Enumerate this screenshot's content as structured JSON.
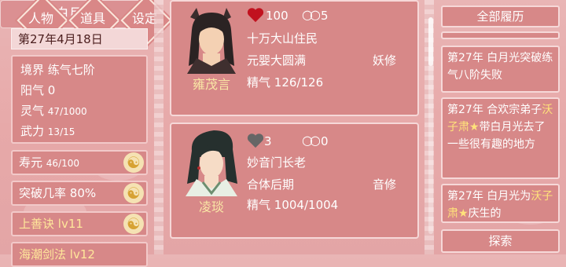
{
  "player": {
    "name": "白月光",
    "date": "第27年4月18日",
    "stats": {
      "realm_label": "境界",
      "realm_value": "练气七阶",
      "yang_label": "阳气",
      "yang_value": "0",
      "spirit_label": "灵气",
      "spirit_value": "47/1000",
      "force_label": "武力",
      "force_value": "13/15"
    },
    "lifespan_label": "寿元",
    "lifespan_value": "46/100",
    "breakthrough_label": "突破几率",
    "breakthrough_value": "80%",
    "skill1_name": "上善诀",
    "skill1_level": "lv11",
    "skill2_name": "海潮剑法",
    "skill2_level": "lv12"
  },
  "menu": {
    "character": "人物",
    "items": "道具",
    "settings": "设定"
  },
  "characters": [
    {
      "name": "雍茂言",
      "affection": "100",
      "bond": "5",
      "identity": "十万大山住民",
      "cultivation": "元婴大圆满",
      "race": "妖修",
      "essence_label": "精气",
      "essence_value": "126/126",
      "heart_color": "#c1121f"
    },
    {
      "name": "凌琰",
      "affection": "3",
      "bond": "0",
      "identity": "妙音门长老",
      "cultivation": "合体后期",
      "race": "音修",
      "essence_label": "精气",
      "essence_value": "1004/1004",
      "heart_color": "#666666"
    }
  ],
  "history": {
    "header": "全部履历",
    "entries": [
      {
        "year": "第27年",
        "text": "白月光突破练气八阶失败"
      },
      {
        "year": "第27年",
        "prefix": "合欢宗弟子",
        "highlight": "沃子肃★",
        "text": "带白月光去了一些很有趣的地方"
      },
      {
        "year": "第27年",
        "prefix": "白月光为",
        "highlight": "沃子肃★",
        "text": "庆生的"
      }
    ],
    "explore_button": "探索"
  },
  "colors": {
    "card_bg": "#d78888",
    "card_border": "#f6d8d8",
    "gold_text": "#ffe27a",
    "name_text": "#f9e6a5"
  }
}
